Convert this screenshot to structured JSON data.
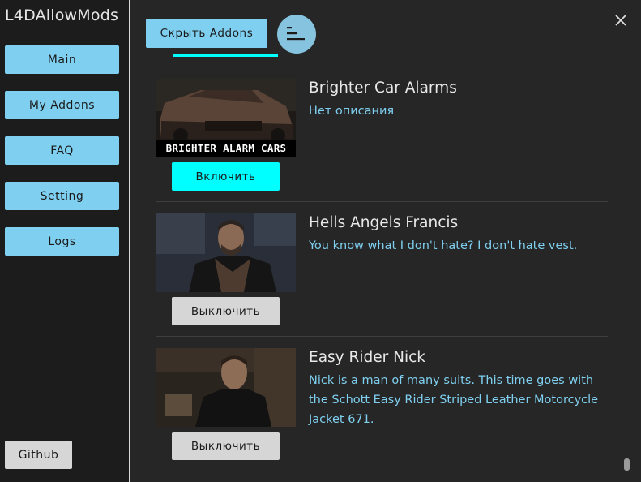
{
  "app_title": "L4DAllowMods",
  "nav": {
    "main": "Main",
    "my_addons": "My Addons",
    "faq": "FAQ",
    "setting": "Setting",
    "logs": "Logs"
  },
  "github_label": "Github",
  "toolbar": {
    "hide_addons_label": "Скрыть Addons",
    "sort_icon": "sort-bars-icon",
    "close_icon": "close-icon"
  },
  "addons": [
    {
      "title": "Brighter Car Alarms",
      "description": "Нет описания",
      "thumb_caption": "BRIGHTER ALARM CARS",
      "button_label": "Включить",
      "enabled": false
    },
    {
      "title": "Hells Angels Francis",
      "description": "You know what I don't hate? I don't hate vest.",
      "button_label": "Выключить",
      "enabled": true
    },
    {
      "title": "Easy Rider Nick",
      "description": "Nick is a man of many suits. This time goes with the Schott Easy Rider Striped Leather Motorcycle Jacket 671.",
      "button_label": "Выключить",
      "enabled": true
    }
  ],
  "colors": {
    "accent": "#7fd0f0",
    "enable_button": "#00ffff",
    "disable_button": "#d6d6d6",
    "background": "#262626",
    "sidebar": "#1c1c1c"
  }
}
